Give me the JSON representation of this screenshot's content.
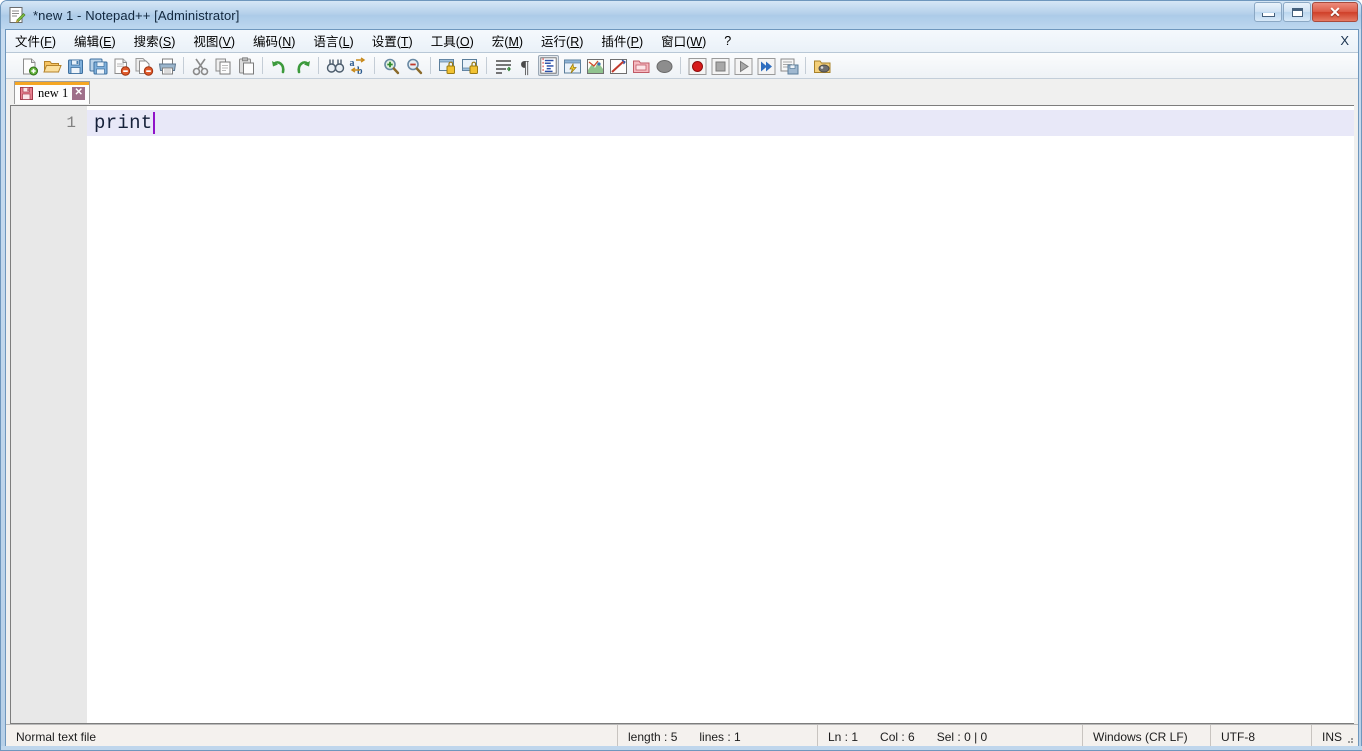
{
  "window": {
    "title": "*new 1 - Notepad++ [Administrator]",
    "app_icon": "notepad-plus-plus-icon",
    "controls": {
      "minimize": "minimize-button",
      "maximize": "maximize-button",
      "close": "close-button",
      "close_glyph": "✕"
    },
    "colors": {
      "titlebar": "#b5d0ea",
      "frame_border": "#6f97bd",
      "close_button": "#cf3f28",
      "active_tab_top": "#f5a623",
      "caret": "#9013c9",
      "current_line": "#e8e8f8",
      "gutter": "#e8e8e8"
    }
  },
  "menubar": {
    "items": [
      {
        "label": "文件(F)",
        "text": "文件(",
        "key": "F",
        "tail": ")"
      },
      {
        "label": "编辑(E)",
        "text": "编辑(",
        "key": "E",
        "tail": ")"
      },
      {
        "label": "搜索(S)",
        "text": "搜索(",
        "key": "S",
        "tail": ")"
      },
      {
        "label": "视图(V)",
        "text": "视图(",
        "key": "V",
        "tail": ")"
      },
      {
        "label": "编码(N)",
        "text": "编码(",
        "key": "N",
        "tail": ")"
      },
      {
        "label": "语言(L)",
        "text": "语言(",
        "key": "L",
        "tail": ")"
      },
      {
        "label": "设置(T)",
        "text": "设置(",
        "key": "T",
        "tail": ")"
      },
      {
        "label": "工具(O)",
        "text": "工具(",
        "key": "O",
        "tail": ")"
      },
      {
        "label": "宏(M)",
        "text": "宏(",
        "key": "M",
        "tail": ")"
      },
      {
        "label": "运行(R)",
        "text": "运行(",
        "key": "R",
        "tail": ")"
      },
      {
        "label": "插件(P)",
        "text": "插件(",
        "key": "P",
        "tail": ")"
      },
      {
        "label": "窗口(W)",
        "text": "窗口(",
        "key": "W",
        "tail": ")"
      },
      {
        "label": "?",
        "text": "?",
        "key": "",
        "tail": ""
      }
    ],
    "close_doc": "X"
  },
  "toolbar": {
    "buttons": [
      {
        "name": "new-file-icon",
        "active": false
      },
      {
        "name": "open-file-icon",
        "active": false
      },
      {
        "name": "save-icon",
        "active": false
      },
      {
        "name": "save-all-icon",
        "active": false
      },
      {
        "name": "close-file-icon",
        "active": false
      },
      {
        "name": "close-all-files-icon",
        "active": false
      },
      {
        "name": "print-icon",
        "active": false
      },
      {
        "name": "separator",
        "active": false
      },
      {
        "name": "cut-icon",
        "active": false
      },
      {
        "name": "copy-icon",
        "active": false
      },
      {
        "name": "paste-icon",
        "active": false
      },
      {
        "name": "separator",
        "active": false
      },
      {
        "name": "undo-icon",
        "active": false
      },
      {
        "name": "redo-icon",
        "active": false
      },
      {
        "name": "separator",
        "active": false
      },
      {
        "name": "find-icon",
        "active": false
      },
      {
        "name": "replace-icon",
        "active": false
      },
      {
        "name": "separator",
        "active": false
      },
      {
        "name": "zoom-in-icon",
        "active": false
      },
      {
        "name": "zoom-out-icon",
        "active": false
      },
      {
        "name": "separator",
        "active": false
      },
      {
        "name": "sync-vertical-scroll-icon",
        "active": false
      },
      {
        "name": "sync-horizontal-scroll-icon",
        "active": false
      },
      {
        "name": "separator",
        "active": false
      },
      {
        "name": "word-wrap-icon",
        "active": false
      },
      {
        "name": "show-all-characters-icon",
        "active": false
      },
      {
        "name": "indent-guide-icon",
        "active": true
      },
      {
        "name": "user-defined-dialog-icon",
        "active": false
      },
      {
        "name": "document-map-icon",
        "active": false
      },
      {
        "name": "function-list-icon",
        "active": false
      },
      {
        "name": "folder-as-workspace-icon",
        "active": false
      },
      {
        "name": "monitoring-icon",
        "active": false
      },
      {
        "name": "separator",
        "active": false
      },
      {
        "name": "record-macro-icon",
        "active": false
      },
      {
        "name": "stop-recording-icon",
        "active": false
      },
      {
        "name": "play-macro-icon",
        "active": false
      },
      {
        "name": "run-macro-multiple-icon",
        "active": false
      },
      {
        "name": "save-macro-icon",
        "active": false
      },
      {
        "name": "separator",
        "active": false
      },
      {
        "name": "run-icon",
        "active": false
      }
    ]
  },
  "tabs": [
    {
      "label": "new 1",
      "modified": true,
      "active": true,
      "close_glyph": "✕"
    }
  ],
  "editor": {
    "lines": [
      {
        "number": "1",
        "text": "print",
        "current": true
      }
    ],
    "caret_after": "print"
  },
  "statusbar": {
    "file_type": "Normal text file",
    "length_label": "length : 5",
    "lines_label": "lines : 1",
    "ln": "Ln : 1",
    "col": "Col : 6",
    "sel": "Sel : 0 | 0",
    "eol": "Windows (CR LF)",
    "encoding": "UTF-8",
    "insert_mode": "INS"
  }
}
